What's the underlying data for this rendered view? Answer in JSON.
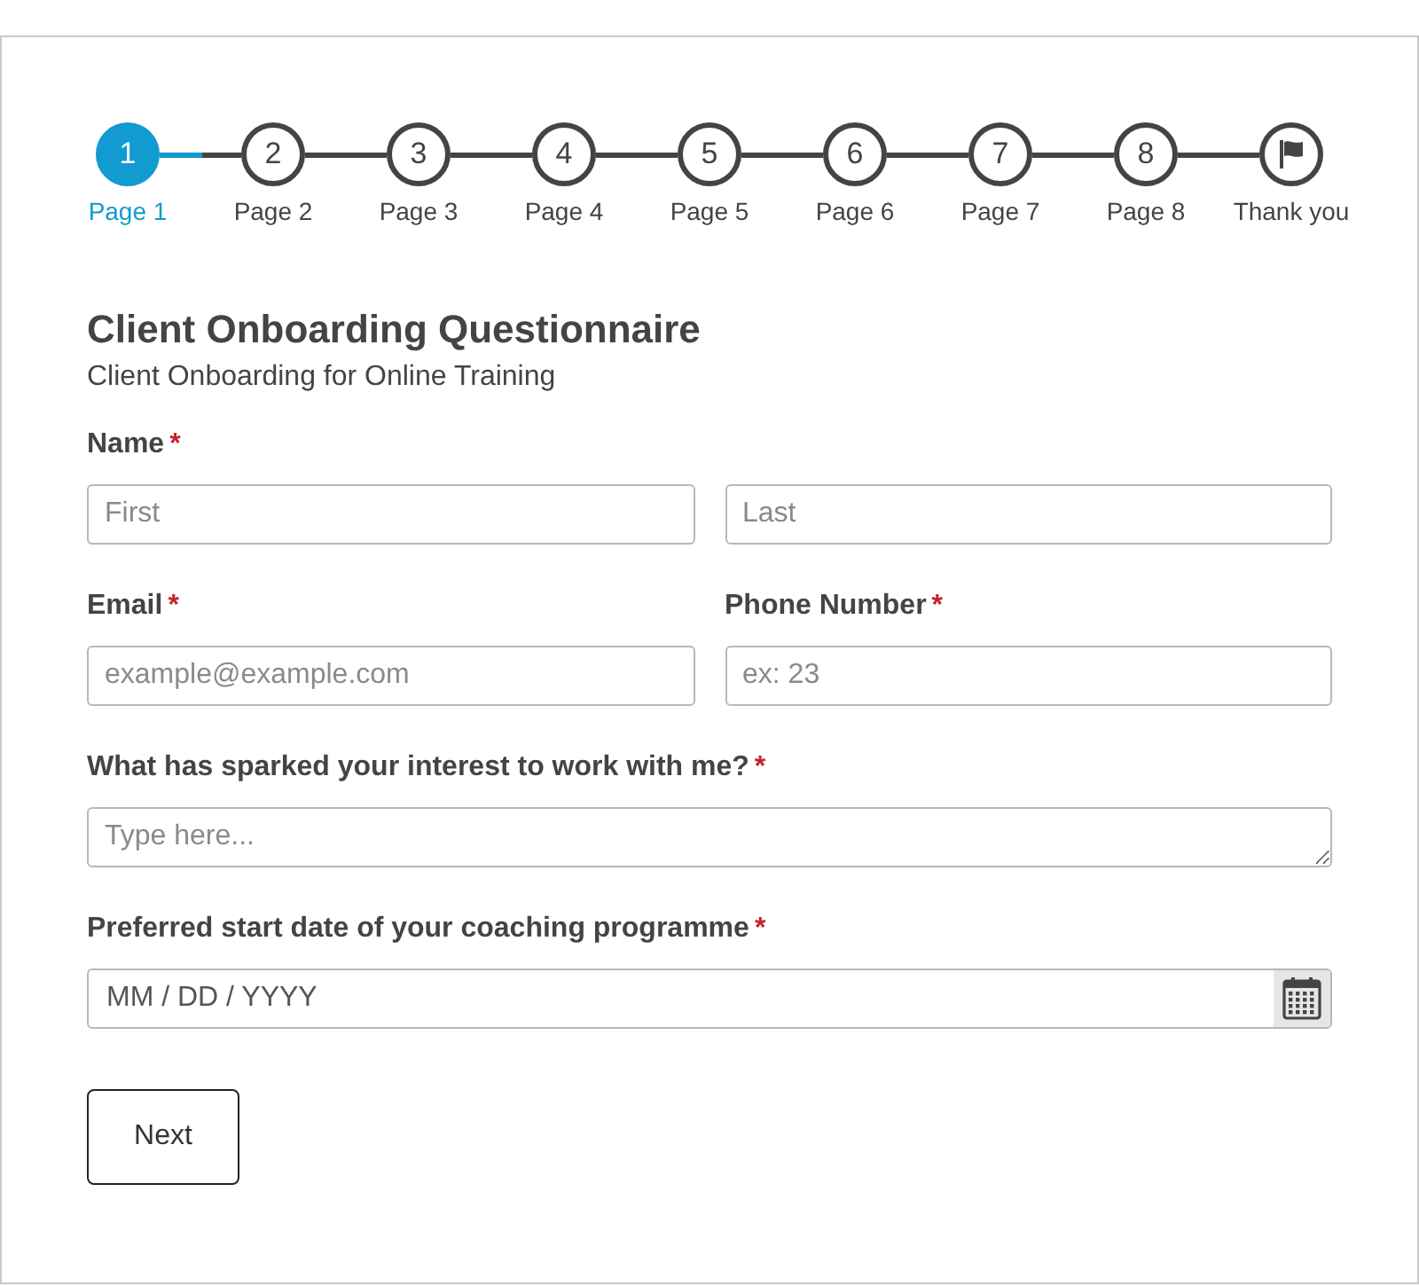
{
  "steps": [
    {
      "kind": "number",
      "number": "1",
      "label": "Page 1",
      "selected": true
    },
    {
      "kind": "number",
      "number": "2",
      "label": "Page 2",
      "selected": false
    },
    {
      "kind": "number",
      "number": "3",
      "label": "Page 3",
      "selected": false
    },
    {
      "kind": "number",
      "number": "4",
      "label": "Page 4",
      "selected": false
    },
    {
      "kind": "number",
      "number": "5",
      "label": "Page 5",
      "selected": false
    },
    {
      "kind": "number",
      "number": "6",
      "label": "Page 6",
      "selected": false
    },
    {
      "kind": "number",
      "number": "7",
      "label": "Page 7",
      "selected": false
    },
    {
      "kind": "number",
      "number": "8",
      "label": "Page 8",
      "selected": false
    },
    {
      "kind": "flag",
      "label": "Thank you",
      "selected": false
    }
  ],
  "form": {
    "title": "Client Onboarding Questionnaire",
    "subtitle": "Client Onboarding for Online Training",
    "rows": [
      [
        {
          "kind": "name",
          "label": "Name",
          "required_mark": "*",
          "inputs": [
            {
              "placeholder": "First"
            },
            {
              "placeholder": "Last"
            }
          ]
        }
      ],
      [
        {
          "kind": "text",
          "label": "Email",
          "required_mark": "*",
          "placeholder": "example@example.com"
        },
        {
          "kind": "text",
          "label": "Phone Number",
          "required_mark": "*",
          "placeholder": "ex: 23"
        }
      ],
      [
        {
          "kind": "textarea",
          "label": "What has sparked your interest to work with me?",
          "required_mark": "*",
          "placeholder": "Type here..."
        }
      ],
      [
        {
          "kind": "date",
          "label": "Preferred start date of your coaching programme",
          "required_mark": "*",
          "placeholder": "MM / DD / YYYY"
        }
      ]
    ],
    "buttons": [
      {
        "label": "Next"
      }
    ]
  }
}
